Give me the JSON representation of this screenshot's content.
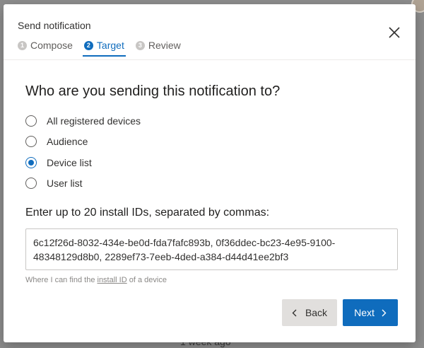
{
  "background": {
    "footer_text": "1 week ago"
  },
  "dialog": {
    "title": "Send notification",
    "steps": [
      {
        "number": "1",
        "label": "Compose",
        "active": false
      },
      {
        "number": "2",
        "label": "Target",
        "active": true
      },
      {
        "number": "3",
        "label": "Review",
        "active": false
      }
    ],
    "question": "Who are you sending this notification to?",
    "target_options": [
      {
        "label": "All registered devices",
        "selected": false
      },
      {
        "label": "Audience",
        "selected": false
      },
      {
        "label": "Device list",
        "selected": true
      },
      {
        "label": "User list",
        "selected": false
      }
    ],
    "install_ids_label": "Enter up to 20 install IDs, separated by commas:",
    "install_ids_value": "6c12f26d-8032-434e-be0d-fda7fafc893b, 0f36ddec-bc23-4e95-9100-48348129d8b0, 2289ef73-7eeb-4ded-a384-d44d41ee2bf3",
    "help_text_prefix": "Where I can find the ",
    "help_link": "install ID",
    "help_text_suffix": " of a device",
    "back_label": "Back",
    "next_label": "Next",
    "icons": {
      "close": "close-icon",
      "back": "chevron-left-icon",
      "next": "chevron-right-icon"
    },
    "colors": {
      "accent": "#0f6cbd",
      "secondary_button": "#e1dfdd"
    }
  }
}
